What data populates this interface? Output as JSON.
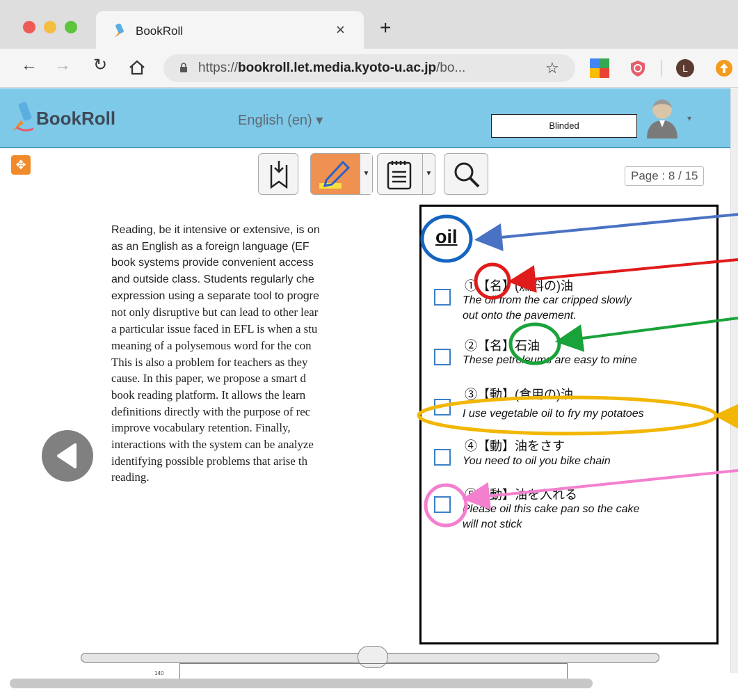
{
  "browser": {
    "tab_title": "BookRoll",
    "tab_close": "×",
    "new_tab": "+",
    "url_prefix": "https://",
    "url_domain": "bookroll.let.media.kyoto-u.ac.jp",
    "url_rest": "/bo...",
    "profile_initial": "L",
    "colors": {
      "traffic_red": "#ee5b55",
      "traffic_yellow": "#f4be40",
      "traffic_green": "#5dc43d"
    }
  },
  "app": {
    "logo": "BookRoll",
    "language": "English (en) ▾",
    "user_name": "Blinded",
    "user_caret": "▾",
    "page_indicator": "Page : 8 / 15",
    "accent": "#7ec8e8"
  },
  "reading": {
    "lines": [
      "Reading, be it intensive or extensive, is on",
      "as an English as a foreign language (EF",
      "book systems provide convenient access",
      "and outside class. Students regularly che",
      "expression using a separate tool to progre",
      "not only disruptive but can lead to other lear",
      "a particular issue faced in EFL is when a stu",
      "meaning of a polysemous word for the con",
      "This is also a problem for teachers as they",
      "cause. In this paper, we propose a smart d",
      "book reading platform. It allows the learn",
      "definitions directly with the purpose of rec",
      "improve  vocabulary  retention.  Finally,",
      "interactions with the system can be analyze",
      "identifying possible problems that arise th",
      "reading."
    ]
  },
  "dictionary": {
    "word": "oil",
    "definitions": [
      {
        "num": "①",
        "pos": "【名】",
        "meaning": "(燃料の)油",
        "example": [
          "The oil from the car cripped slowly",
          "out onto the pavement."
        ]
      },
      {
        "num": "②",
        "pos": "【名】",
        "meaning": "石油",
        "example": [
          "These petroleums are easy to mine"
        ]
      },
      {
        "num": "③",
        "pos": "【動】",
        "meaning": "(食用の)油",
        "example": [
          "I use vegetable oil to fry my potatoes"
        ]
      },
      {
        "num": "④",
        "pos": "【動】",
        "meaning": "油をさす",
        "example": [
          "You need to oil you bike chain"
        ]
      },
      {
        "num": "⑤",
        "pos": "【動】",
        "meaning": "油を入れる",
        "example": [
          "Please oil this cake pan so the cake",
          "will not stick"
        ]
      }
    ]
  },
  "slider": {
    "mini_label": "140"
  }
}
